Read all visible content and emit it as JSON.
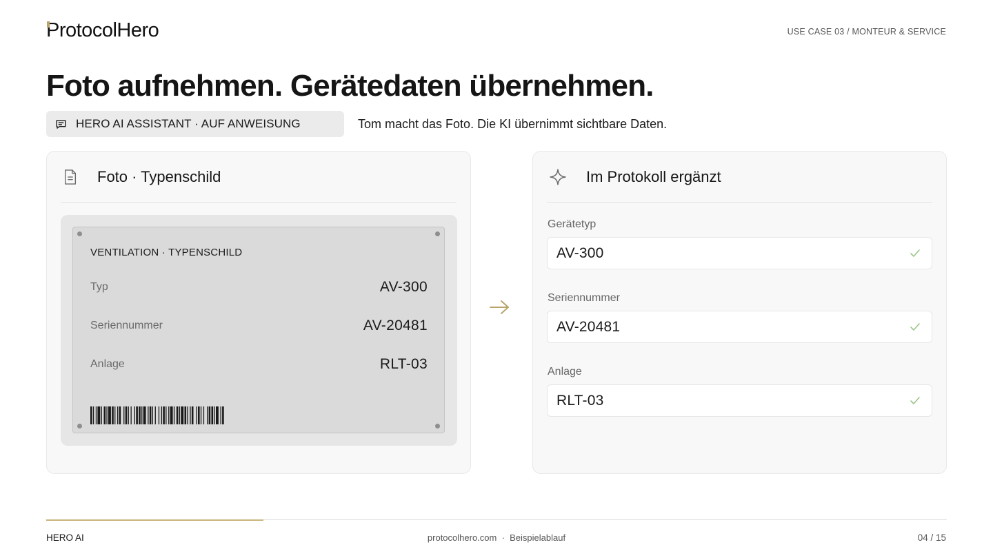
{
  "brand": {
    "logo_text_p": "P",
    "logo_text_rest": "rotocolHero"
  },
  "header": {
    "use_case": "USE CASE 03 / MONTEUR & SERVICE"
  },
  "title": "Foto aufnehmen. Gerätedaten übernehmen.",
  "assistant": {
    "label": "HERO AI ASSISTANT · AUF ANWEISUNG",
    "description": "Tom macht das Foto. Die KI übernimmt sichtbare Daten."
  },
  "photo_card": {
    "title": "Foto · Typenschild",
    "plate_title": "VENTILATION · TYPENSCHILD",
    "rows": [
      {
        "key": "Typ",
        "value": "AV-300"
      },
      {
        "key": "Seriennummer",
        "value": "AV-20481"
      },
      {
        "key": "Anlage",
        "value": "RLT-03"
      }
    ]
  },
  "protocol_card": {
    "title": "Im Protokoll ergänzt",
    "fields": [
      {
        "label": "Gerätetyp",
        "value": "AV-300"
      },
      {
        "label": "Seriennummer",
        "value": "AV-20481"
      },
      {
        "label": "Anlage",
        "value": "RLT-03"
      }
    ]
  },
  "footer": {
    "left": "HERO AI",
    "center": "protocolhero.com  ·  Beispielablauf",
    "page": "04 / 15"
  },
  "progress": {
    "fraction": 0.241
  },
  "colors": {
    "accent": "#c9b47a",
    "check": "#9cc48a",
    "arrow": "#b9a46a"
  },
  "icons": {
    "assistant": "chat-icon",
    "photo": "document-icon",
    "protocol": "sparkle-icon",
    "flow": "arrow-right-icon",
    "field_status": "check-icon"
  }
}
